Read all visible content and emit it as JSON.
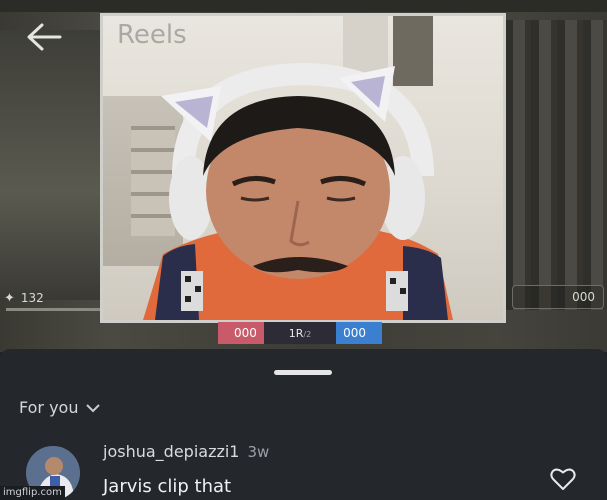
{
  "video": {
    "title": "Reels",
    "hud_left_value": "132",
    "hud_right_value": "000",
    "score": {
      "left": "000",
      "middle": "1R",
      "middle_sub": "/2",
      "right": "000"
    }
  },
  "comments": {
    "filter_label": "For you",
    "items": [
      {
        "username": "joshua_depiazzi1",
        "age": "3w",
        "text": "Jarvis clip that"
      }
    ]
  },
  "watermark": "imgflip.com",
  "colors": {
    "sheet_bg": "#24272c",
    "video_frame": "#cfcfcb",
    "score_red": "#c85a6a",
    "score_blue": "#3a7fd0"
  }
}
